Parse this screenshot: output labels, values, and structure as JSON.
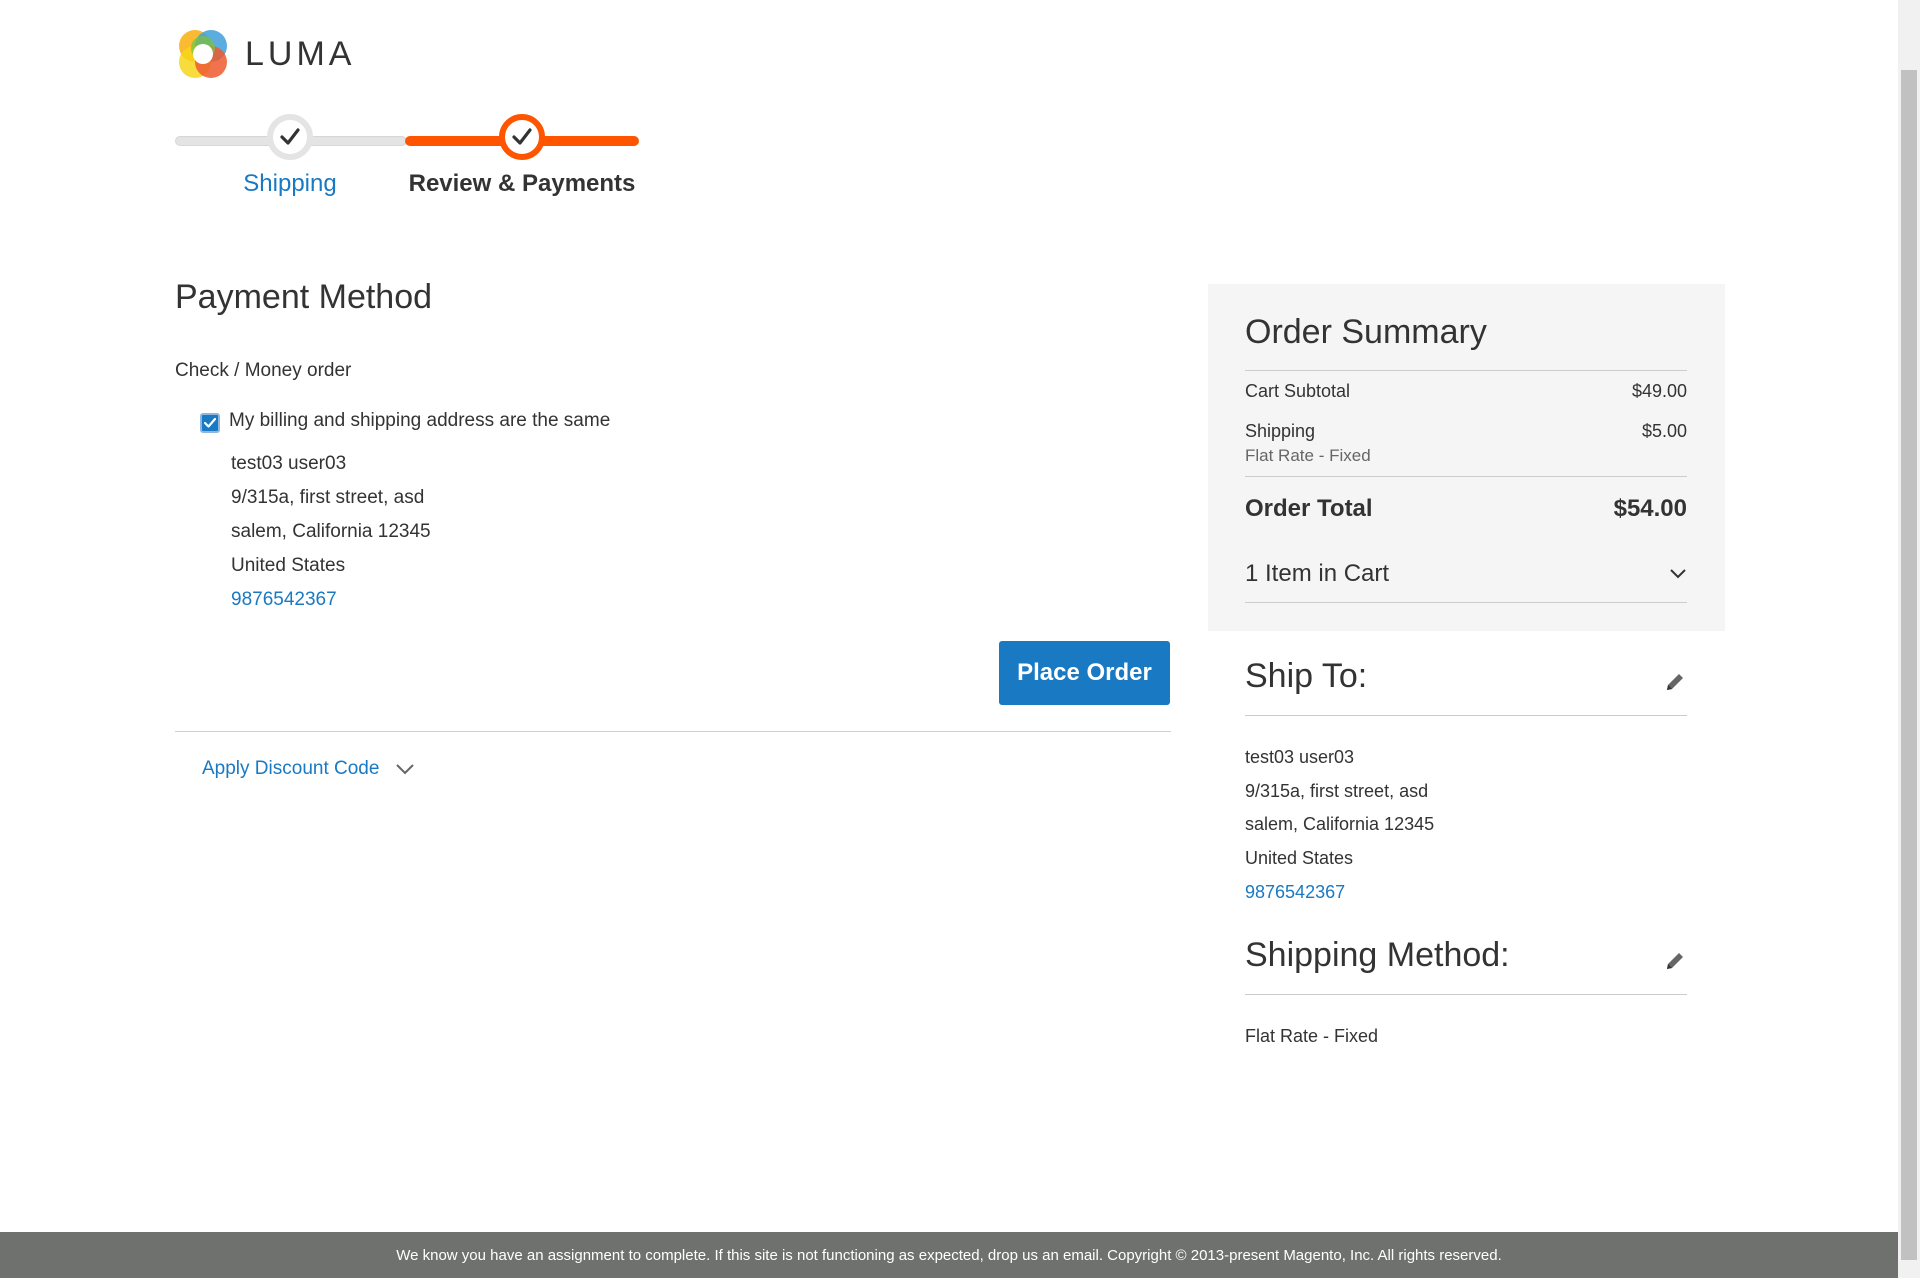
{
  "brand": {
    "logo_text": "LUMA"
  },
  "progress": {
    "steps": [
      {
        "label": "Shipping",
        "state": "complete"
      },
      {
        "label": "Review & Payments",
        "state": "active"
      }
    ]
  },
  "payment": {
    "title": "Payment Method",
    "method_name": "Check / Money order",
    "same_address_label": "My billing and shipping address are the same",
    "same_address_checked": true,
    "address": {
      "name": "test03 user03",
      "street": "9/315a, first street, asd",
      "city_line": "salem, California 12345",
      "country": "United States",
      "phone": "9876542367"
    },
    "place_order_label": "Place Order",
    "discount_label": "Apply Discount Code"
  },
  "summary": {
    "title": "Order Summary",
    "subtotal_label": "Cart Subtotal",
    "subtotal_value": "$49.00",
    "shipping_label": "Shipping",
    "shipping_value": "$5.00",
    "shipping_method": "Flat Rate - Fixed",
    "total_label": "Order Total",
    "total_value": "$54.00",
    "items_label": "1 Item in Cart"
  },
  "ship_to": {
    "title": "Ship To:",
    "name": "test03 user03",
    "street": "9/315a, first street, asd",
    "city_line": "salem, California 12345",
    "country": "United States",
    "phone": "9876542367"
  },
  "shipping_method": {
    "title": "Shipping Method:",
    "value": "Flat Rate - Fixed"
  },
  "footer": {
    "text": "We know you have an assignment to complete. If this site is not functioning as expected, drop us an email. Copyright © 2013-present Magento, Inc. All rights reserved."
  },
  "colors": {
    "accent": "#1979c3",
    "progress_active": "#ff5501",
    "footer_bg": "#6e716e",
    "summary_bg": "#f5f5f5"
  }
}
